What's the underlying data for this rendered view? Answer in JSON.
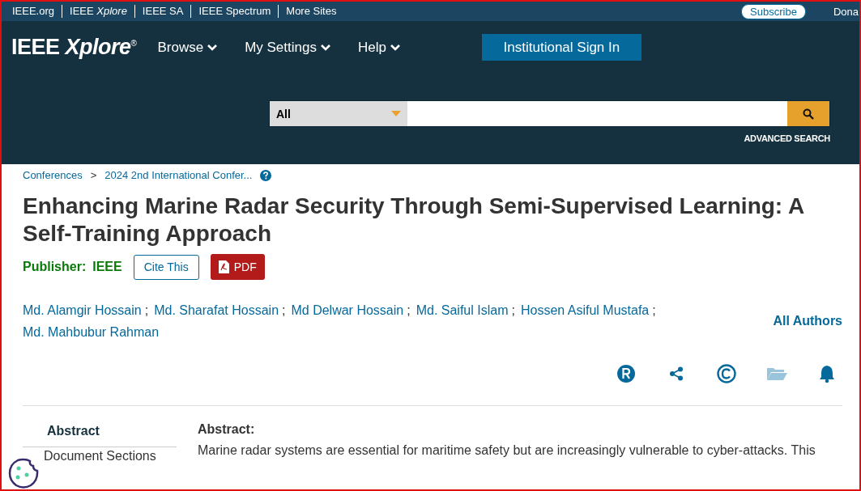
{
  "top_links": [
    {
      "label": "IEEE.org"
    },
    {
      "label": "IEEE *Xplore*"
    },
    {
      "label": "IEEE SA"
    },
    {
      "label": "IEEE Spectrum"
    },
    {
      "label": "More Sites"
    }
  ],
  "subscribe": "Subscribe",
  "donate": "Dona",
  "logo": "IEEE *Xplore*$^{®}$",
  "nav": [
    "Browse",
    "My Settings",
    "Help"
  ],
  "sign_in": "Institutional Sign In",
  "search": {
    "scope": "All",
    "advanced": "ADVANCED SEARCH"
  },
  "breadcrumb": {
    "items": [
      "Conferences",
      "2024 2nd International Confer..."
    ],
    "separator": ">"
  },
  "title": "Enhancing Marine Radar Security Through Semi-Supervised Learning: A Self-Training Approach",
  "publisher": {
    "label": "Publisher:",
    "value": "IEEE"
  },
  "cite": "Cite This",
  "pdf": "PDF",
  "authors": {
    "separator": ";",
    "names": [
      "Md. Alamgir Hossain",
      "Md. Sharafat Hossain",
      "Md Delwar Hossain",
      "Md. Saiful Islam",
      "Hossen Asiful Mustafa",
      "Md. Mahbubur Rahman"
    ],
    "all": "All Authors"
  },
  "actions": [
    {
      "kind": "rights",
      "disabled": false
    },
    {
      "kind": "share",
      "disabled": false
    },
    {
      "kind": "copyright",
      "disabled": false
    },
    {
      "kind": "folder",
      "disabled": true
    },
    {
      "kind": "alert",
      "disabled": false
    }
  ],
  "sidebar": [
    {
      "label": "Abstract",
      "selected": true
    },
    {
      "label": "Document Sections",
      "selected": false
    }
  ],
  "abstract": {
    "heading": "Abstract:",
    "text": "Marine radar systems are essential for maritime safety but are increasingly vulnerable to cyber-attacks. This"
  }
}
